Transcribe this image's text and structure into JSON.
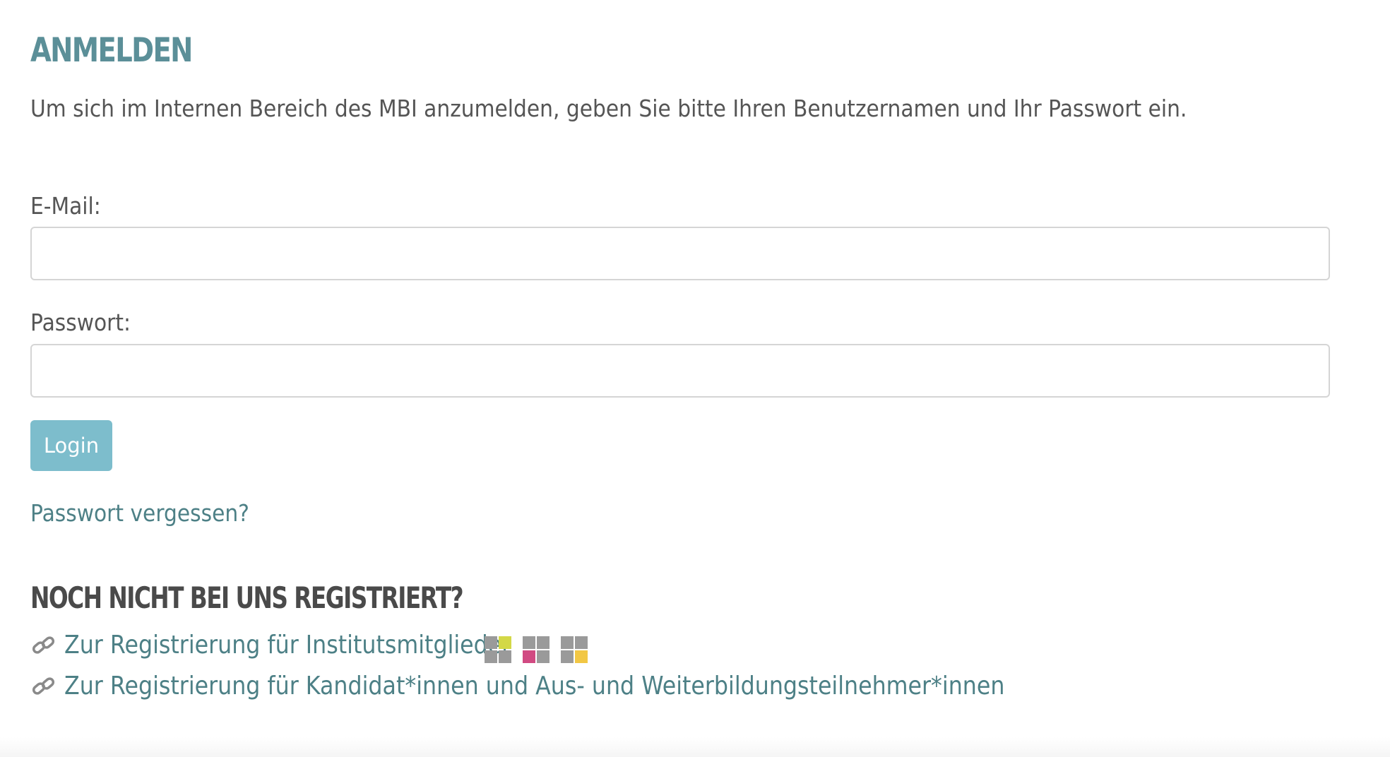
{
  "login": {
    "title": "ANMELDEN",
    "intro": "Um sich im Internen Bereich des MBI anzumelden, geben Sie bitte Ihren Benutzernamen und Ihr Passwort ein.",
    "email_label": "E-Mail:",
    "email_value": "",
    "password_label": "Passwort:",
    "password_value": "",
    "login_button": "Login",
    "forgot_link": "Passwort vergessen?"
  },
  "register": {
    "heading": "NOCH NICHT BEI UNS REGISTRIERT?",
    "links": [
      {
        "label": "Zur Registrierung für Institutsmitglieder",
        "icon": "link-icon"
      },
      {
        "label": "Zur Registrierung für Kandidat*innen und Aus- und Weiterbildungsteilnehmer*innen",
        "icon": "link-icon"
      }
    ],
    "badges": [
      {
        "icon": "grid-badge-icon",
        "accent": "#d3d847"
      },
      {
        "icon": "grid-badge-icon",
        "accent": "#d14a82"
      },
      {
        "icon": "grid-badge-icon",
        "accent": "#f2c744"
      }
    ]
  },
  "colors": {
    "heading": "#5b8f98",
    "link": "#4d8086",
    "button": "#7dbdcc",
    "text": "#555555"
  }
}
